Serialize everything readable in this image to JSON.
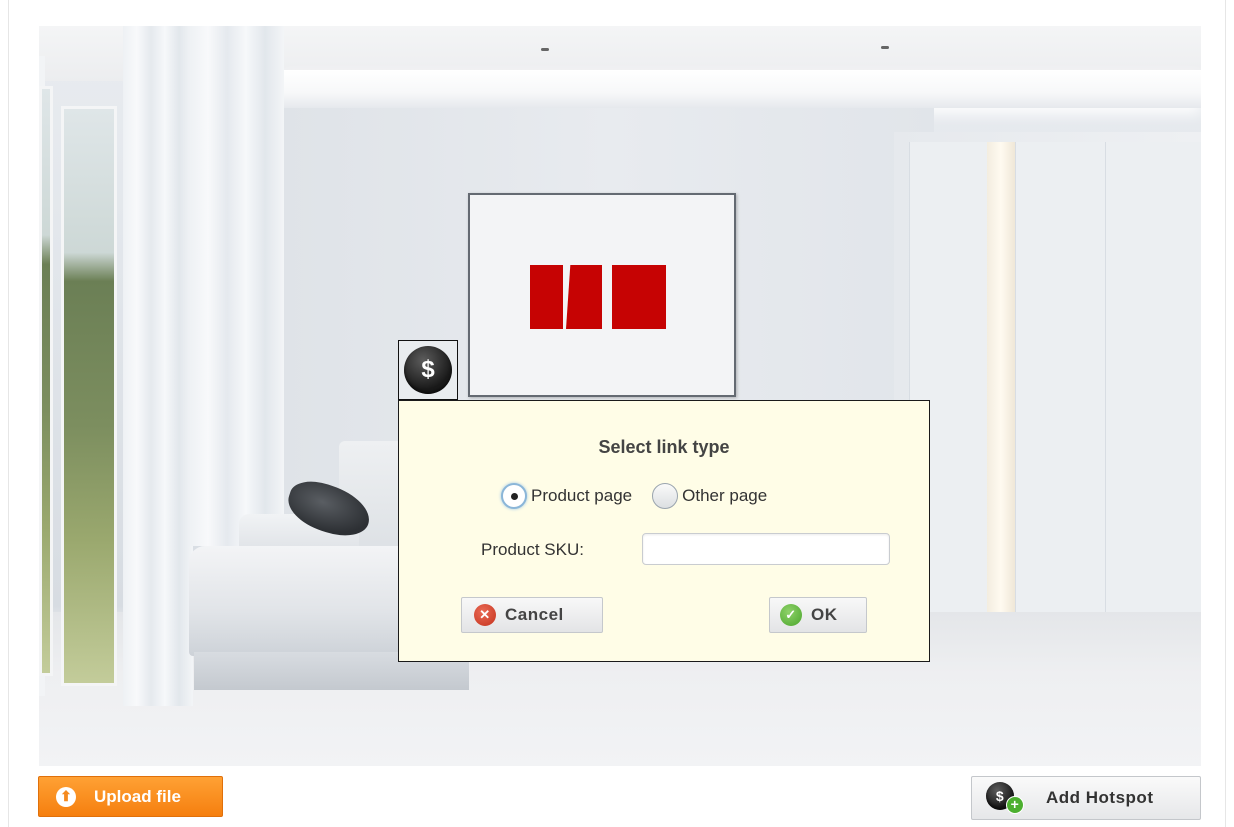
{
  "dialog": {
    "title": "Select link type",
    "link_types": [
      {
        "label": "Product page",
        "selected": true
      },
      {
        "label": "Other page",
        "selected": false
      }
    ],
    "sku_label": "Product SKU:",
    "sku_value": "",
    "cancel_label": "Cancel",
    "ok_label": "OK"
  },
  "hotspot_marker": {
    "icon": "dollar-coin-icon",
    "glyph": "$"
  },
  "toolbar": {
    "upload_label": "Upload file",
    "add_hotspot_label": "Add Hotspot"
  },
  "colors": {
    "upload_button": "#f58a1f",
    "dialog_background": "#fffde7",
    "painting_red": "#c60303"
  }
}
